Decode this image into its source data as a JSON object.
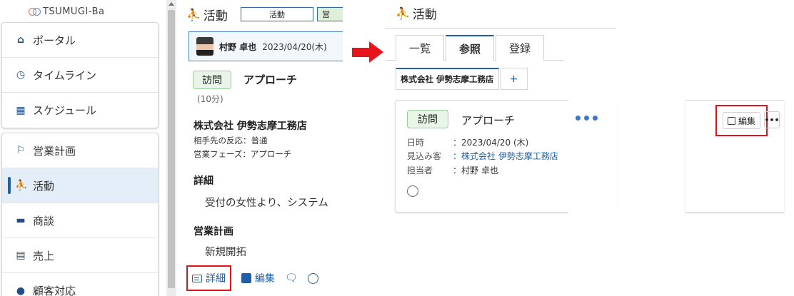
{
  "sidebar": {
    "logo": "TSUMUGI-Ba",
    "group1": [
      {
        "icon": "home-icon",
        "glyph": "⌂",
        "label": "ポータル"
      },
      {
        "icon": "clock-icon",
        "glyph": "◷",
        "label": "タイムライン"
      },
      {
        "icon": "calendar-icon",
        "glyph": "▦",
        "label": "スケジュール"
      }
    ],
    "group2": [
      {
        "icon": "flag-icon",
        "glyph": "⚐",
        "label": "営業計画"
      },
      {
        "icon": "runner-icon",
        "glyph": "⛹",
        "label": "活動"
      },
      {
        "icon": "briefcase-icon",
        "glyph": "▬",
        "label": "商談"
      },
      {
        "icon": "invoice-icon",
        "glyph": "▤",
        "label": "売上"
      },
      {
        "icon": "person-icon",
        "glyph": "●",
        "label": "顧客対応"
      }
    ]
  },
  "middle": {
    "title": "活動",
    "tag1": "活動",
    "tag2": "営",
    "user_name": "村野 卓也",
    "user_date": "2023/04/20(木)",
    "badge": "訪問",
    "approach": "アプローチ",
    "duration": "(10分)",
    "company": "株式会社 伊勢志摩工務店",
    "reaction": "相手先の反応：普通",
    "phase": "営業フェーズ：アプローチ",
    "detail_title": "詳細",
    "detail_text": "受付の女性より、システム",
    "plan_title": "営業計画",
    "plan_text": "新規開拓",
    "toolbar": {
      "detail": "詳細",
      "edit": "編集"
    }
  },
  "right": {
    "title": "活動",
    "tabs": [
      "一覧",
      "参照",
      "登録"
    ],
    "subtab": "株式会社 伊勢志摩工務店",
    "subtab_add": "+",
    "card": {
      "badge": "訪問",
      "title": "アプローチ",
      "rows": [
        {
          "k": "日時",
          "v": "：2023/04/20 (木)"
        },
        {
          "k": "見込み客",
          "v": "：株式会社 伊勢志摩工務店"
        },
        {
          "k": "担当者",
          "v": "：村野 卓也"
        }
      ]
    },
    "edit_label": "編集",
    "more_label": "•••"
  },
  "colors": {
    "accent": "#1e5fa6",
    "highlight": "#e0121a",
    "badge_bg": "#e9f5e9"
  }
}
